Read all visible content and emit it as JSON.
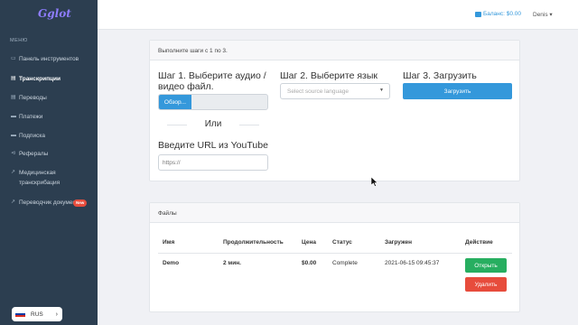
{
  "app": {
    "logo": "Gglot"
  },
  "sidebar": {
    "heading": "МЕНЮ",
    "items": [
      {
        "label": "Панель инструментов",
        "icon": "monitor-icon",
        "glyph": "▭"
      },
      {
        "label": "Транскрипции",
        "icon": "document-icon",
        "glyph": "▤"
      },
      {
        "label": "Переводы",
        "icon": "document-icon",
        "glyph": "▤"
      },
      {
        "label": "Платежи",
        "icon": "credit-card-icon",
        "glyph": "▬"
      },
      {
        "label": "Подписка",
        "icon": "credit-card-icon",
        "glyph": "▬"
      },
      {
        "label": "Рефералы",
        "icon": "share-icon",
        "glyph": "⊲"
      },
      {
        "label": "Медицинская транскрибация",
        "icon": "external-link-icon",
        "glyph": "↗"
      },
      {
        "label": "Переводчик документов",
        "icon": "external-link-icon",
        "glyph": "↗",
        "badge": "New"
      }
    ],
    "language": {
      "code": "RUS"
    }
  },
  "topbar": {
    "balance": "Баланс: $0.00",
    "user": "Denis ▾"
  },
  "upload_card": {
    "header": "Выполните шаги с 1 по 3.",
    "step1": "Шаг 1. Выберите аудио / видео файл.",
    "browse_label": "Обзор...",
    "or_label": "Или",
    "youtube_label": "Введите URL из YouTube",
    "url_placeholder": "https://",
    "step2": "Шаг 2. Выберите язык",
    "language_placeholder": "Select source language",
    "step3": "Шаг 3. Загрузить",
    "upload_label": "Загрузить"
  },
  "files_card": {
    "header": "Файлы",
    "columns": [
      "Имя",
      "Продолжительность",
      "Цена",
      "Статус",
      "Загружен",
      "Действие"
    ],
    "rows": [
      {
        "name": "Demo",
        "duration": "2 мин.",
        "price": "$0.00",
        "status": "Complete",
        "uploaded": "2021-06-15 09:45:37",
        "open_label": "Открыть",
        "delete_label": "Удалить"
      }
    ]
  },
  "colors": {
    "sidebar_bg": "#2c3e50",
    "accent": "#3498db",
    "open_button": "#27ae60",
    "delete_button": "#e74c3c"
  }
}
